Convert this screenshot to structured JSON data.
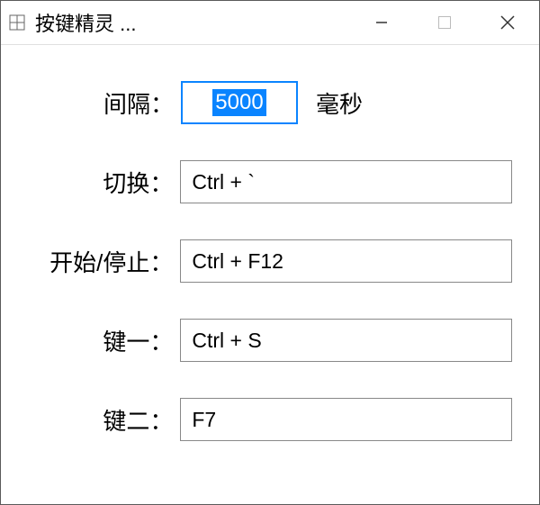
{
  "window": {
    "title": "按键精灵 ..."
  },
  "form": {
    "interval": {
      "label": "间隔：",
      "value": "5000",
      "unit": "毫秒"
    },
    "switch": {
      "label": "切换：",
      "value": "Ctrl + `"
    },
    "startstop": {
      "label": "开始/停止：",
      "value": "Ctrl + F12"
    },
    "key1": {
      "label": "键一：",
      "value": "Ctrl + S"
    },
    "key2": {
      "label": "键二：",
      "value": "F7"
    }
  }
}
